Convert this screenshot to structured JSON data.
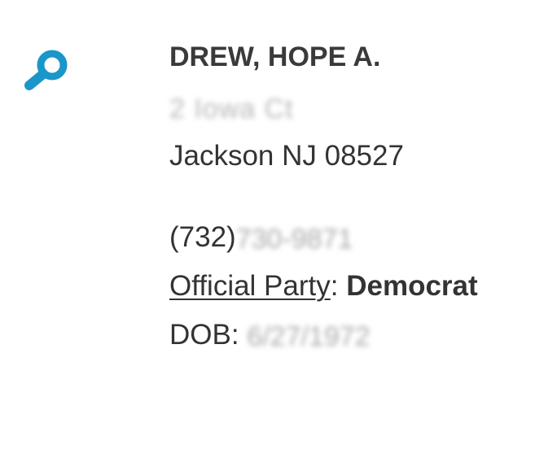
{
  "search": {
    "icon": "magnifier-icon",
    "color": "#1a96c9"
  },
  "record": {
    "name": "DREW, HOPE A.",
    "street": "2 Iowa Ct",
    "city_line": "Jackson NJ 08527",
    "phone_prefix": "(732)",
    "phone_rest": "730-9871",
    "party_label": "Official Party",
    "party_separator": ":",
    "party_value": "Democrat",
    "dob_label": "DOB:",
    "dob_value": "6/27/1972"
  }
}
